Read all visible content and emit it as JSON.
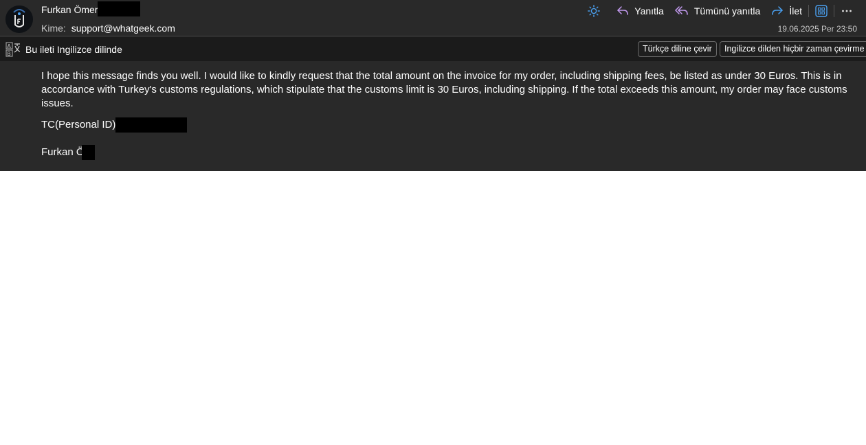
{
  "header": {
    "sender_name": "Furkan Ömer",
    "to_label": "Kime:",
    "to_value": "support@whatgeek.com",
    "date": "19.06.2025 Per 23:50"
  },
  "actions": [
    {
      "name": "sun-icon",
      "label": ""
    },
    {
      "name": "reply",
      "label": "Yanıtla"
    },
    {
      "name": "reply-all",
      "label": "Tümünü yanıtla"
    },
    {
      "name": "forward",
      "label": "İlet"
    }
  ],
  "translate_bar": {
    "message": "Bu ileti Ingilizce dilinde",
    "translate_button": "Türkçe diline çevir",
    "never_button": "Ingilizce dilden hiçbir zaman çevirme"
  },
  "body": {
    "paragraph": "I hope this message finds you well. I would like to kindly request that the total amount on the invoice for my order, including shipping fees, be listed as under 30 Euros. This is in accordance with Turkey's customs regulations, which stipulate that the customs limit is 30 Euros, including shipping. If the total exceeds this amount, my order may face customs issues.",
    "id_label": "TC(Personal ID)",
    "signature": "Furkan Ö"
  },
  "colors": {
    "background": "#292929",
    "bar": "#1b1b1b",
    "accent_blue": "#4aa0f0",
    "reply_purple": "#c39af0"
  }
}
